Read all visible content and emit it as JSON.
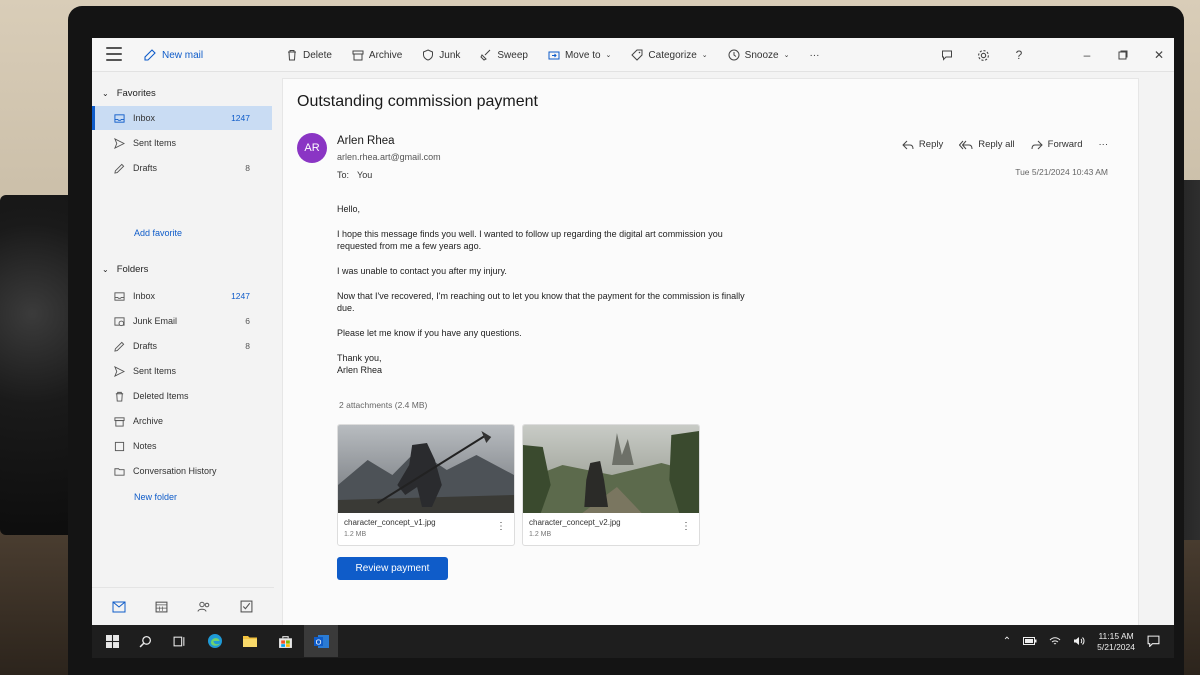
{
  "toolbar": {
    "new_mail": "New mail",
    "delete": "Delete",
    "archive": "Archive",
    "junk": "Junk",
    "sweep": "Sweep",
    "move_to": "Move to",
    "categorize": "Categorize",
    "snooze": "Snooze",
    "more": "···"
  },
  "sidebar": {
    "favorites_label": "Favorites",
    "favorites": [
      {
        "label": "Inbox",
        "count": "1247",
        "icon": "inbox-icon"
      },
      {
        "label": "Sent Items",
        "count": "",
        "icon": "send-icon"
      },
      {
        "label": "Drafts",
        "count": "8",
        "icon": "pencil-icon"
      }
    ],
    "add_favorite": "Add favorite",
    "folders_label": "Folders",
    "folders": [
      {
        "label": "Inbox",
        "count": "1247",
        "icon": "inbox-icon"
      },
      {
        "label": "Junk Email",
        "count": "6",
        "icon": "junk-icon"
      },
      {
        "label": "Drafts",
        "count": "8",
        "icon": "pencil-icon"
      },
      {
        "label": "Sent Items",
        "count": "",
        "icon": "send-icon"
      },
      {
        "label": "Deleted Items",
        "count": "",
        "icon": "trash-icon"
      },
      {
        "label": "Archive",
        "count": "",
        "icon": "archive-icon"
      },
      {
        "label": "Notes",
        "count": "",
        "icon": "note-icon"
      },
      {
        "label": "Conversation History",
        "count": "",
        "icon": "folder-icon"
      }
    ],
    "new_folder": "New folder"
  },
  "message": {
    "subject": "Outstanding commission payment",
    "avatar_initials": "AR",
    "sender_name": "Arlen Rhea",
    "sender_email": "arlen.rhea.art@gmail.com",
    "to_label": "To:",
    "to_value": "You",
    "reply": "Reply",
    "reply_all": "Reply all",
    "forward": "Forward",
    "more": "···",
    "date": "Tue 5/21/2024 10:43 AM",
    "greeting": "Hello,",
    "para1": "I hope this message finds you well. I wanted to follow up regarding the digital art commission you requested from me a few years ago.",
    "para2": "I was unable to contact you after my injury.",
    "para3": "Now that I've recovered, I'm reaching out to let you know that the payment for the commission is finally due.",
    "para4": "Please let me know if you have any questions.",
    "signoff": "Thank you,",
    "signature": "Arlen Rhea",
    "attachments_header": "2 attachments (2.4 MB)",
    "attachments": [
      {
        "name": "character_concept_v1.jpg",
        "size": "1.2 MB"
      },
      {
        "name": "character_concept_v2.jpg",
        "size": "1.2 MB"
      }
    ],
    "review_button": "Review payment"
  },
  "taskbar": {
    "time": "11:15 AM",
    "date": "5/21/2024"
  },
  "colors": {
    "accent": "#0f5cc9",
    "avatar": "#8a35c4",
    "selected_bg": "#c9dcf3"
  }
}
